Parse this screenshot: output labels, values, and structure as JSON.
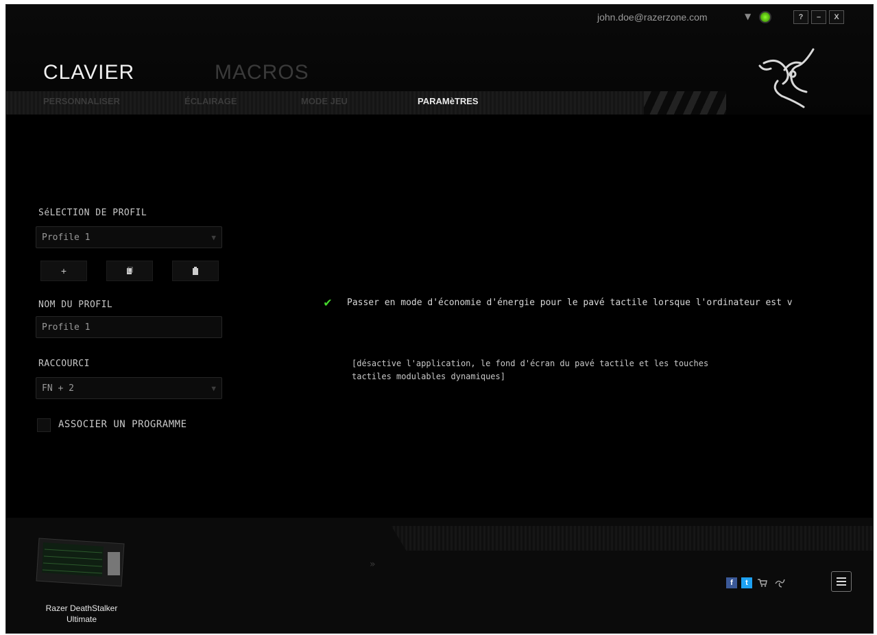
{
  "header": {
    "account_email": "john.doe@razerzone.com",
    "window_buttons": [
      "?",
      "–",
      "X"
    ]
  },
  "main_tabs": [
    {
      "label": "CLAVIER",
      "active": true
    },
    {
      "label": "MACROS",
      "active": false
    }
  ],
  "sub_tabs": [
    {
      "label": "PERSONNALISER",
      "active": false
    },
    {
      "label": "ÉCLAIRAGE",
      "active": false
    },
    {
      "label": "MODE JEU",
      "active": false
    },
    {
      "label": "PARAMèTRES",
      "active": true
    }
  ],
  "sidebar": {
    "profile_section_label": "SéLECTION DE PROFIL",
    "profile_select_value": "Profile 1",
    "profile_buttons": {
      "add": "+",
      "copy": "⧉",
      "delete": "🗑"
    },
    "profile_name_label": "NOM DU PROFIL",
    "profile_name_value": "Profile 1",
    "shortcut_label": "RACCOURCI",
    "shortcut_value": "FN + 2",
    "associate_program_label": "ASSOCIER UN PROGRAMME",
    "associate_program_checked": false
  },
  "settings": {
    "power_saving_checked": true,
    "power_saving_label": "Passer en mode d'économie d'énergie pour le pavé tactile lorsque l'ordinateur est v",
    "power_saving_description": "[désactive l'application, le fond d'écran du pavé tactile et les touches tactiles modulables dynamiques]"
  },
  "footer": {
    "device_name": "Razer DeathStalker Ultimate",
    "icons": [
      "facebook-icon",
      "twitter-icon",
      "cart-icon",
      "razer-icon",
      "menu-icon"
    ]
  },
  "colors": {
    "accent": "#44d62c",
    "facebook": "#3b5998",
    "twitter": "#1da1f2"
  }
}
